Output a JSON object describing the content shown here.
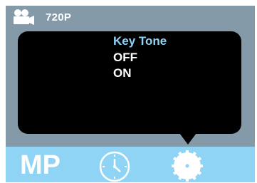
{
  "status": {
    "resolution": "720P",
    "mode_icon": "video-camera-icon"
  },
  "menu": {
    "title": "Key Tone",
    "options": [
      "OFF",
      "ON"
    ]
  },
  "bottom_bar": {
    "mode_label": "MP",
    "icons": [
      "clock-icon",
      "settings-gear-icon"
    ]
  },
  "colors": {
    "frame": "#849aa8",
    "popup": "#000000",
    "accent": "#8fd3f5",
    "text": "#ffffff"
  }
}
